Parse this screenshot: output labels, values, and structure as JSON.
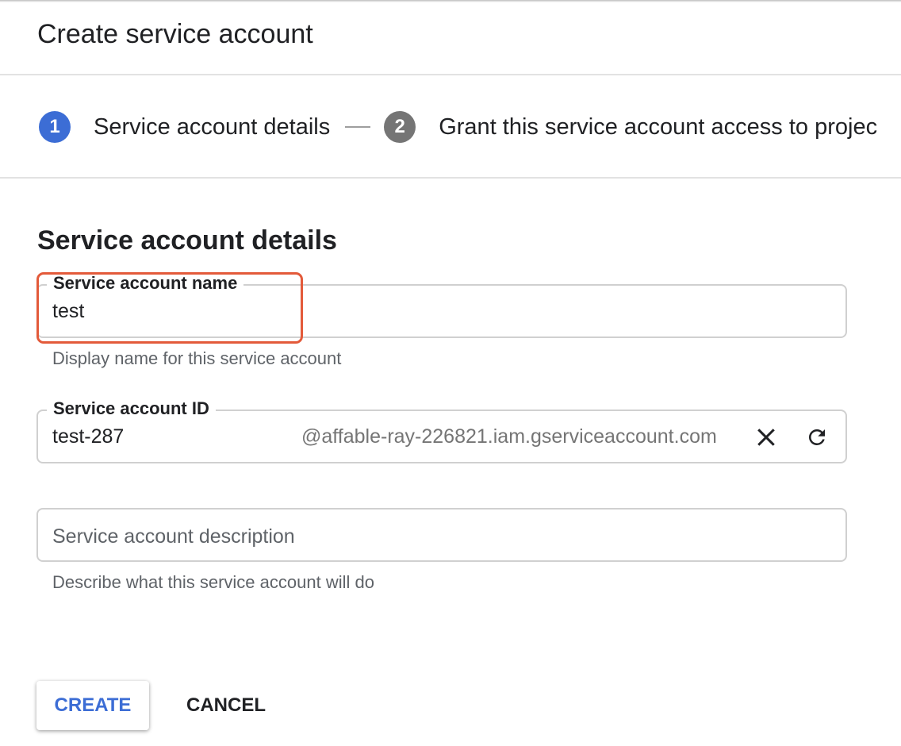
{
  "page": {
    "title": "Create service account"
  },
  "stepper": {
    "steps": [
      {
        "number": "1",
        "label": "Service account details",
        "state": "active"
      },
      {
        "number": "2",
        "label": "Grant this service account access to projec",
        "state": "inactive"
      }
    ]
  },
  "section": {
    "heading": "Service account details"
  },
  "form": {
    "name_field": {
      "label": "Service account name",
      "value": "test",
      "helper": "Display name for this service account"
    },
    "id_field": {
      "label": "Service account ID",
      "value": "test-287",
      "suffix": "@affable-ray-226821.iam.gserviceaccount.com",
      "clear_icon": "close-icon",
      "refresh_icon": "refresh-icon"
    },
    "description_field": {
      "placeholder": "Service account description",
      "helper": "Describe what this service account will do"
    }
  },
  "actions": {
    "create_label": "CREATE",
    "cancel_label": "CANCEL"
  },
  "colors": {
    "accent": "#3c6dd5",
    "inactive_step": "#757575",
    "highlight": "#e35a3a",
    "border": "#d0d0d0"
  }
}
